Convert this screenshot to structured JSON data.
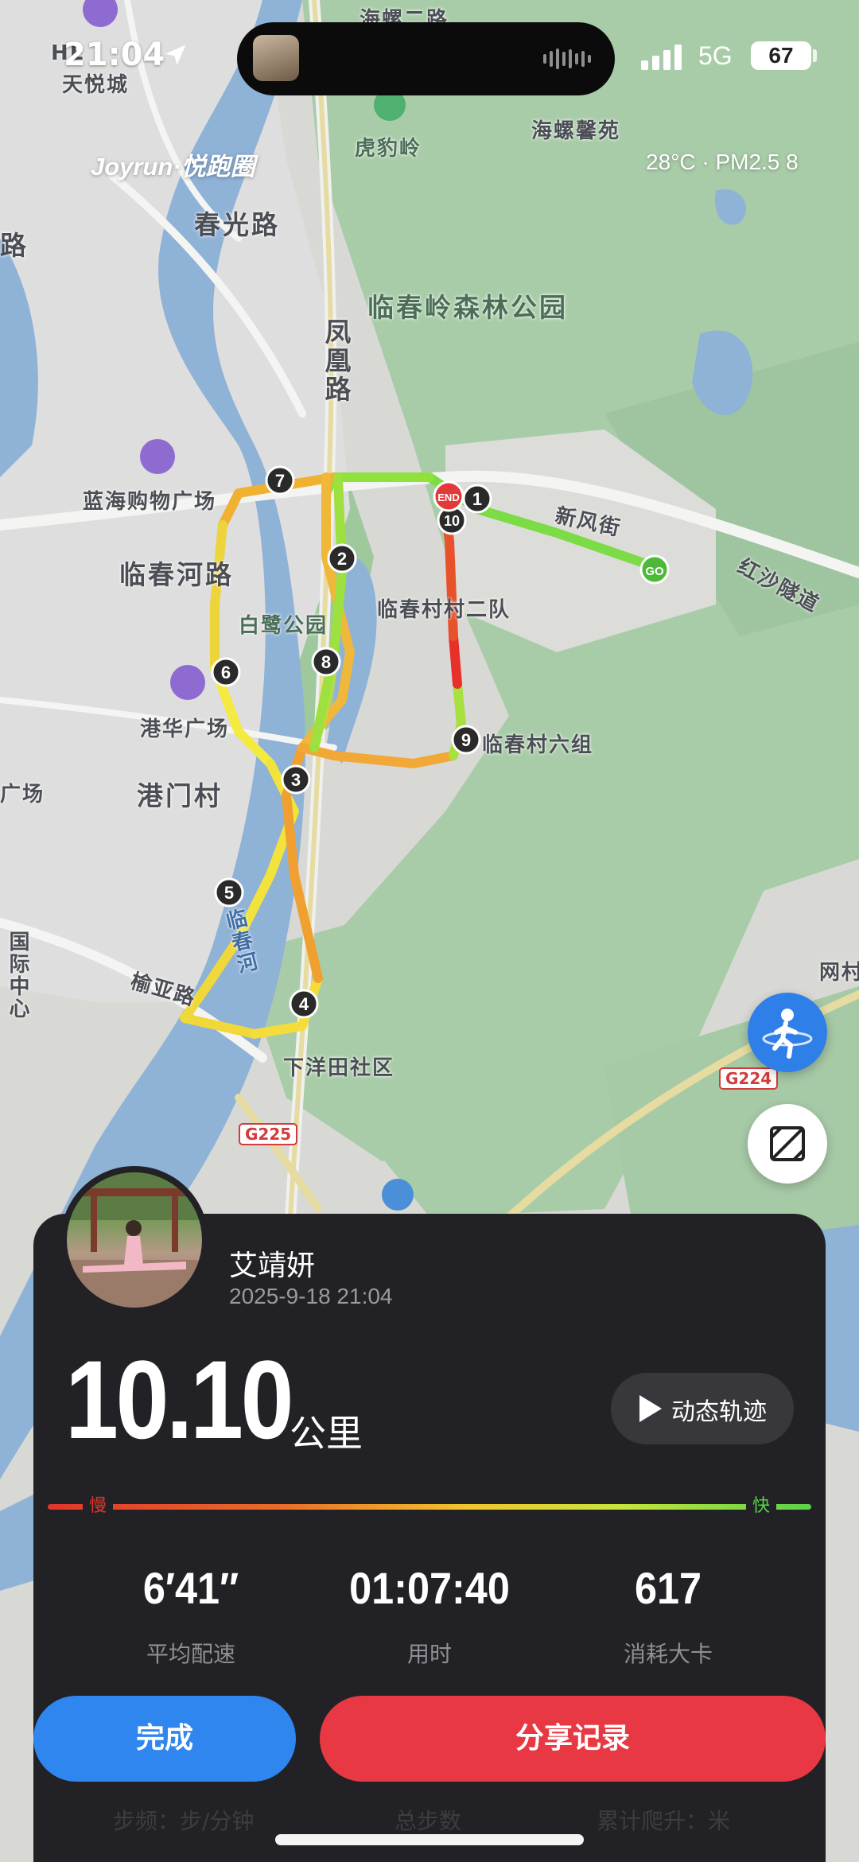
{
  "status_bar": {
    "time": "21:04",
    "network": "5G",
    "battery": "67"
  },
  "brand": "Joyrun·悦跑圈",
  "weather": "28°C · PM2.5 8",
  "map": {
    "labels": {
      "tianyue": "天悦城",
      "hengshi": "HE",
      "huboling": "虎豹岭",
      "hailuoxinyuan": "海螺馨苑",
      "chunguanglu": "春光路",
      "forest_park": "临春岭森林公园",
      "fenghuanglu": "凤凰路",
      "lanhai_mall": "蓝海购物广场",
      "linchunhe_road": "临春河路",
      "bailu_park": "白鹭公园",
      "village_2": "临春村村二队",
      "xinfeng_street": "新风街",
      "hongsha_tunnel": "红沙隧道",
      "ganghua_plaza": "港华广场",
      "village_6": "临春村六组",
      "gangmen": "港门村",
      "linchunhe": "临春河",
      "yuya_road": "榆亚路",
      "xiayangtian": "下洋田社区",
      "g225": "G225",
      "g224": "G224",
      "wangcun": "网村",
      "left_lu": "路",
      "left_chang": "广场",
      "left_guoji": "国际中心",
      "top_road": "海螺二路"
    },
    "start_marker": "GO",
    "end_marker": "END",
    "km_markers": [
      "1",
      "2",
      "3",
      "4",
      "5",
      "6",
      "7",
      "8",
      "9",
      "10"
    ]
  },
  "profile": {
    "name": "艾靖妍",
    "datetime": "2025-9-18 21:04"
  },
  "distance": {
    "value": "10.10",
    "unit": "公里"
  },
  "playback_label": "动态轨迹",
  "pace_legend": {
    "slow": "慢",
    "fast": "快"
  },
  "stats": [
    {
      "value": "6′41″",
      "label": "平均配速"
    },
    {
      "value": "01:07:40",
      "label": "用时"
    },
    {
      "value": "617",
      "label": "消耗大卡"
    }
  ],
  "buttons": {
    "done": "完成",
    "share": "分享记录"
  },
  "behind_row": [
    "步频：步/分钟",
    "总步数",
    "累计爬升：米"
  ],
  "colors": {
    "done_button": "#2f86ee",
    "share_button": "#e83843",
    "card_bg": "#222226",
    "pace_slow": "#e2352c",
    "pace_fast": "#5ad24a"
  }
}
